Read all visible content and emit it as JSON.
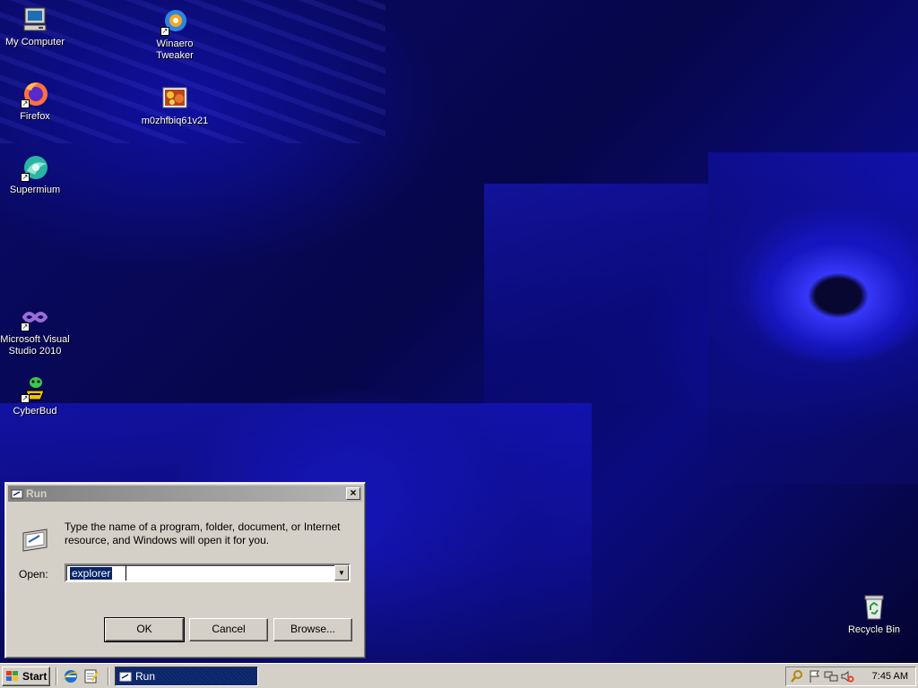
{
  "desktop": {
    "icons": [
      {
        "label": "My Computer",
        "icon": "computer-icon"
      },
      {
        "label": "Winaero Tweaker",
        "icon": "winaero-icon"
      },
      {
        "label": "Firefox",
        "icon": "firefox-icon"
      },
      {
        "label": "m0zhfbiq61v21",
        "icon": "image-file-icon"
      },
      {
        "label": "Supermium",
        "icon": "supermium-icon"
      },
      {
        "label": "Microsoft Visual Studio 2010",
        "icon": "visual-studio-icon"
      },
      {
        "label": "CyberBud",
        "icon": "cyberbud-icon"
      },
      {
        "label": "Recycle Bin",
        "icon": "recycle-bin-icon"
      }
    ],
    "recycle_label": "Recycle Bin"
  },
  "run_dialog": {
    "title": "Run",
    "description": "Type the name of a program, folder, document, or Internet resource, and Windows will open it for you.",
    "open_label": "Open:",
    "open_value": "explorer",
    "ok_label": "OK",
    "cancel_label": "Cancel",
    "browse_label": "Browse..."
  },
  "taskbar": {
    "start_label": "Start",
    "tasks": [
      {
        "label": "Run"
      }
    ],
    "clock": "7:45 AM"
  },
  "colors": {
    "face": "#d4d0c8",
    "active_task": "#0a246a",
    "selection": "#0a246a"
  }
}
